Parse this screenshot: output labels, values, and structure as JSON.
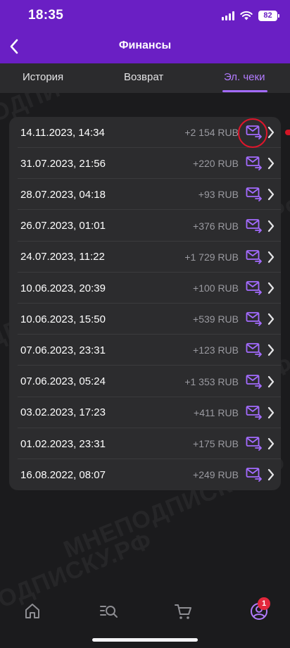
{
  "status_bar": {
    "time": "18:35",
    "battery": "82",
    "icons": [
      "signal-icon",
      "wifi-icon",
      "battery-icon"
    ]
  },
  "nav": {
    "title": "Финансы",
    "back_icon": "chevron-left-icon"
  },
  "tabs": [
    {
      "label": "История",
      "active": false
    },
    {
      "label": "Возврат",
      "active": false
    },
    {
      "label": "Эл. чеки",
      "active": true
    }
  ],
  "receipts": [
    {
      "date": "14.11.2023, 14:34",
      "amount": "+2 154 RUB"
    },
    {
      "date": "31.07.2023, 21:56",
      "amount": "+220 RUB"
    },
    {
      "date": "28.07.2023, 04:18",
      "amount": "+93 RUB"
    },
    {
      "date": "26.07.2023, 01:01",
      "amount": "+376 RUB"
    },
    {
      "date": "24.07.2023, 11:22",
      "amount": "+1 729 RUB"
    },
    {
      "date": "10.06.2023, 20:39",
      "amount": "+100 RUB"
    },
    {
      "date": "10.06.2023, 15:50",
      "amount": "+539 RUB"
    },
    {
      "date": "07.06.2023, 23:31",
      "amount": "+123 RUB"
    },
    {
      "date": "07.06.2023, 05:24",
      "amount": "+1 353 RUB"
    },
    {
      "date": "03.02.2023, 17:23",
      "amount": "+411 RUB"
    },
    {
      "date": "01.02.2023, 23:31",
      "amount": "+175 RUB"
    },
    {
      "date": "16.08.2022, 08:07",
      "amount": "+249 RUB"
    }
  ],
  "watermark_text": "МНЕПОДПИСКУ.РФ",
  "bottom_bar": {
    "items": [
      "home-icon",
      "search-list-icon",
      "cart-icon",
      "profile-icon"
    ],
    "profile_badge": "1"
  },
  "colors": {
    "header": "#6a1fc4",
    "accent": "#a36bff",
    "background": "#1b1b1d",
    "card": "#2c2c2e",
    "highlight": "#e0152b"
  }
}
